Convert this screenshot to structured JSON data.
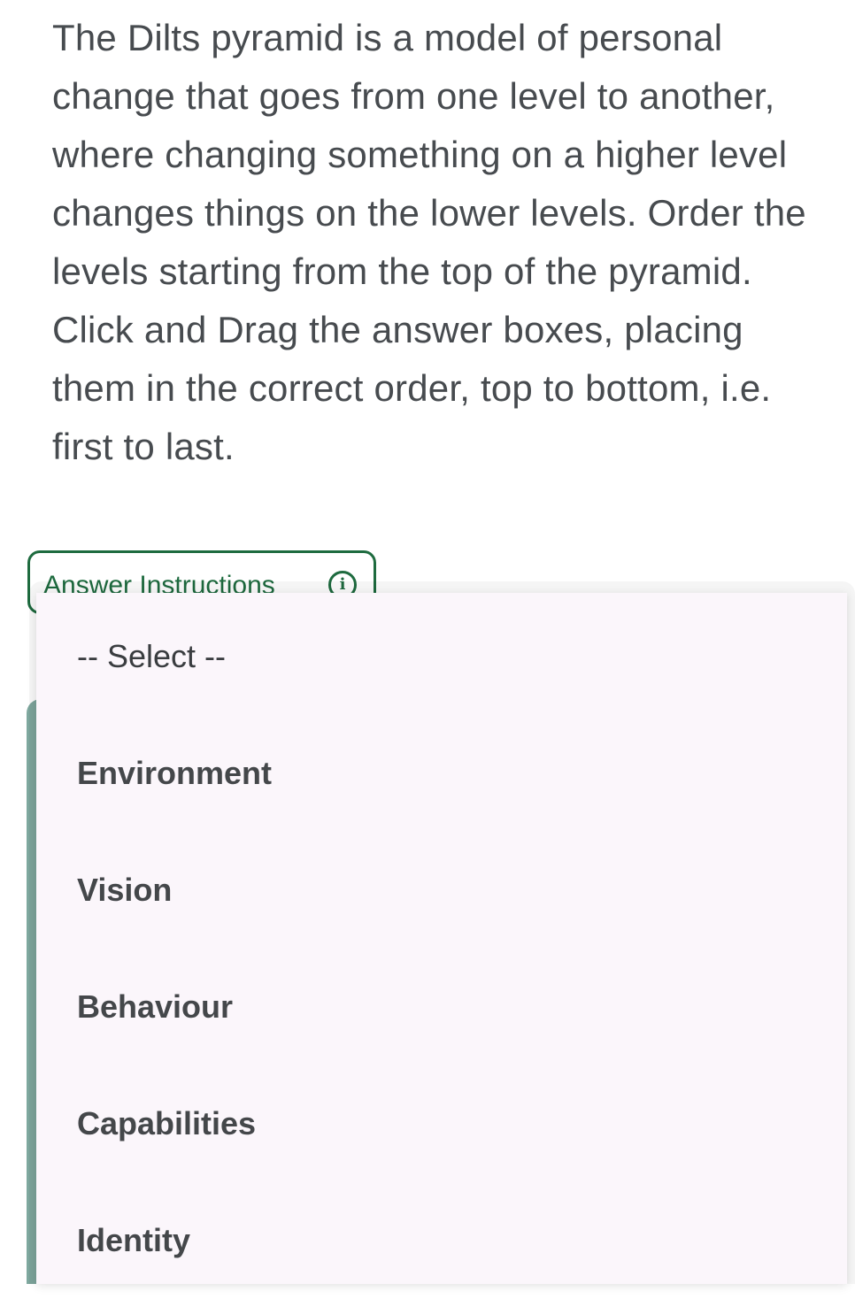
{
  "question": {
    "text": "The Dilts pyramid is a model of personal change that goes from one level to another, where changing something on a higher level changes things on the lower levels. Order the levels starting from the top of the pyramid. Click and Drag the answer boxes, placing them in the correct order, top to bottom, i.e. first to last."
  },
  "answer_instructions": {
    "label": "Answer Instructions",
    "icon": "info-icon"
  },
  "dropdown": {
    "placeholder": "-- Select --",
    "options": [
      {
        "label": "Environment"
      },
      {
        "label": "Vision"
      },
      {
        "label": "Behaviour"
      },
      {
        "label": "Capabilities"
      },
      {
        "label": "Identity"
      }
    ]
  },
  "colors": {
    "text": "#474b4f",
    "accent_green": "#1e6b3f",
    "handle": "#7fa89f",
    "dropdown_bg": "#fbf6fb"
  }
}
